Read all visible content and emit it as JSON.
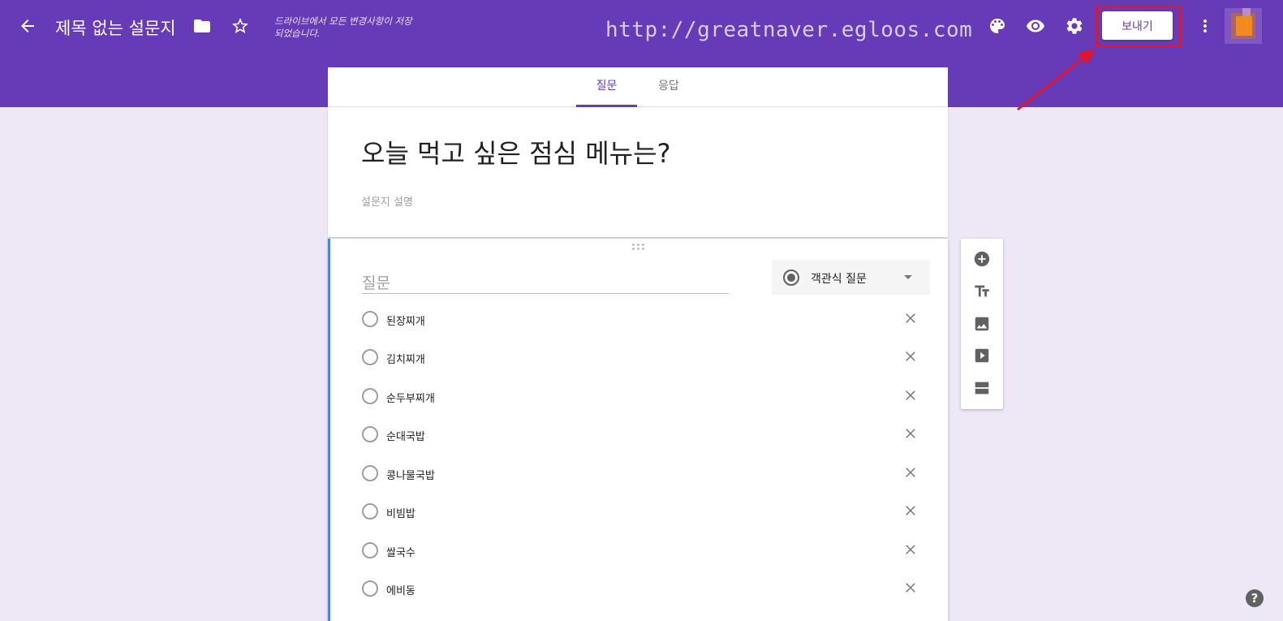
{
  "header": {
    "doc_title": "제목 없는 설문지",
    "save_status": "드라이브에서 모든 변경사항이 저장되었습니다.",
    "watermark": "http://greatnaver.egloos.com",
    "send_label": "보내기",
    "icons": [
      "back-arrow-icon",
      "folder-icon",
      "star-icon",
      "palette-icon",
      "eye-icon",
      "gear-icon",
      "more-vert-icon"
    ],
    "highlight_color": "#e3152b"
  },
  "tabs": [
    {
      "label": "질문",
      "active": true
    },
    {
      "label": "응답",
      "active": false
    }
  ],
  "form": {
    "title": "오늘 먹고 싶은 점심 메뉴는?",
    "description_placeholder": "설문지 설명"
  },
  "question": {
    "placeholder": "질문",
    "type_label": "객관식 질문",
    "options": [
      "된장찌개",
      "김치찌개",
      "순두부찌개",
      "순대국밥",
      "콩나물국밥",
      "비빔밥",
      "쌀국수",
      "에비동"
    ]
  },
  "side_tools": [
    "add-question-icon",
    "add-title-icon",
    "add-image-icon",
    "add-video-icon",
    "add-section-icon"
  ],
  "help_label": "?",
  "colors": {
    "theme": "#673ab7",
    "background": "#ede7f6",
    "active_card_border": "#4285f4"
  }
}
